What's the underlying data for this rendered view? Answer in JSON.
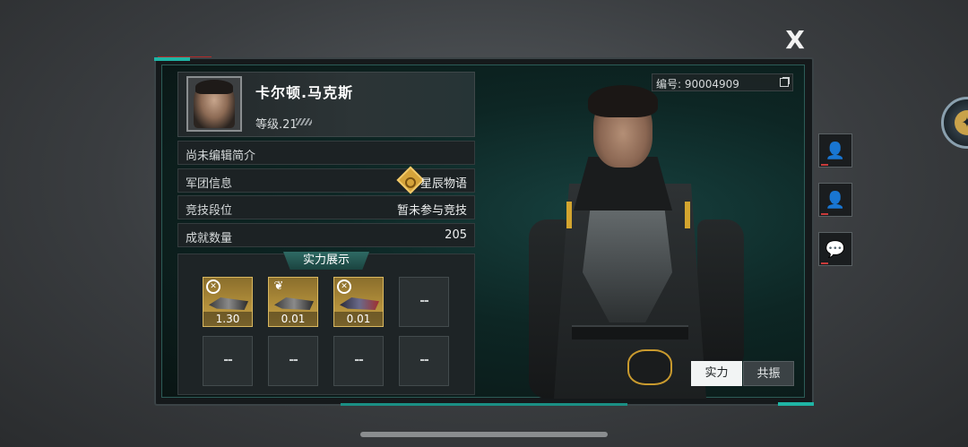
{
  "close_label": "X",
  "profile": {
    "name": "卡尔顿.马克斯",
    "level": "等级.21",
    "bio": "尚未编辑简介",
    "id_text": "编号: 90004909"
  },
  "rows": [
    {
      "label": "军团信息",
      "value": "星辰物语"
    },
    {
      "label": "竞技段位",
      "value": "暂未参与竞技"
    },
    {
      "label": "成就数量",
      "value": "205"
    }
  ],
  "showcase": {
    "title": "实力展示",
    "slots": [
      {
        "value": "1.30",
        "badge": "target-icon"
      },
      {
        "value": "0.01",
        "badge": "leaf-icon"
      },
      {
        "value": "0.01",
        "badge": "target-icon"
      },
      {
        "value": "--"
      },
      {
        "value": "--"
      },
      {
        "value": "--"
      },
      {
        "value": "--"
      },
      {
        "value": "--"
      }
    ]
  },
  "tabs": {
    "strength": "实力",
    "resonance": "共振"
  },
  "colors": {
    "accent_teal": "#1fb5a5",
    "gold": "#c9a548",
    "alert_red": "#c83a3a"
  }
}
